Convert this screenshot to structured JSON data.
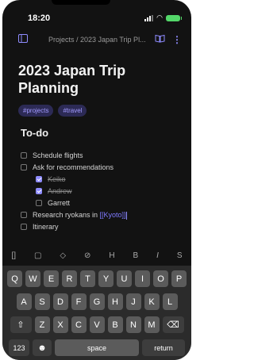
{
  "status_bar": {
    "time": "18:20"
  },
  "header": {
    "breadcrumb": "Projects / 2023 Japan Trip Pl...",
    "icons": [
      "sidebar-icon",
      "book-icon",
      "more-icon"
    ]
  },
  "note": {
    "title": "2023 Japan Trip Planning",
    "tags": [
      "#projects",
      "#travel"
    ],
    "section_heading": "To-do",
    "todos": [
      {
        "label": "Schedule flights",
        "checked": false,
        "indent": 0
      },
      {
        "label": "Ask for recommendations",
        "checked": false,
        "indent": 0
      },
      {
        "label": "Keiko",
        "checked": true,
        "indent": 1
      },
      {
        "label": "Andrew",
        "checked": true,
        "indent": 1
      },
      {
        "label": "Garrett",
        "checked": false,
        "indent": 1
      },
      {
        "label_prefix": "Research ryokans in ",
        "link_text": "[[Kyoto]]",
        "checked": false,
        "indent": 0
      },
      {
        "label": "Itinerary",
        "checked": false,
        "indent": 0
      }
    ]
  },
  "toolbar": {
    "items": [
      "[]",
      "▢",
      "◇",
      "⊘",
      "H",
      "B",
      "I",
      "S"
    ],
    "icons": [
      "brackets-icon",
      "file-icon",
      "tag-icon",
      "attachment-icon",
      "heading-icon",
      "bold-icon",
      "italic-icon",
      "strikethrough-icon"
    ]
  },
  "keyboard": {
    "row1": [
      "Q",
      "W",
      "E",
      "R",
      "T",
      "Y",
      "U",
      "I",
      "O",
      "P"
    ],
    "row2": [
      "A",
      "S",
      "D",
      "F",
      "G",
      "H",
      "J",
      "K",
      "L"
    ],
    "row3": [
      "Z",
      "X",
      "C",
      "V",
      "B",
      "N",
      "M"
    ],
    "shift": "⇧",
    "backspace": "⌫",
    "numbers": "123",
    "emoji": "☻",
    "space": "space",
    "return": "return"
  },
  "colors": {
    "accent": "#8f8cff",
    "background": "#121212",
    "keyboard": "#2b2b2b",
    "battery": "#53d769"
  }
}
